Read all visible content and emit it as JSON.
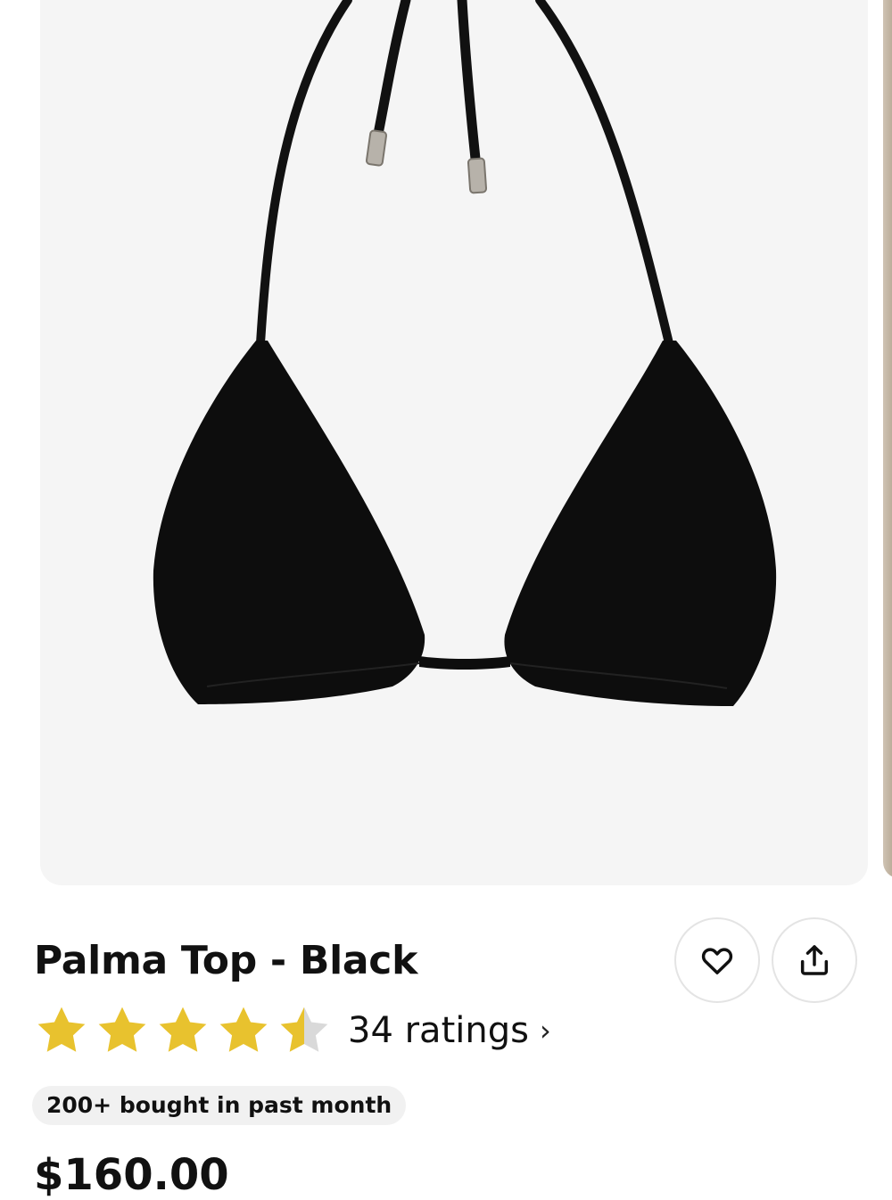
{
  "product": {
    "title": "Palma Top - Black",
    "rating": 4.5,
    "rating_max": 5,
    "ratings_label": "34 ratings",
    "ratings_chevron": "›",
    "bought_badge": "200+ bought in past month",
    "price": "$160.00"
  },
  "actions": {
    "favorite_icon": "heart-icon",
    "share_icon": "share-icon"
  },
  "colors": {
    "star": "#E8C22E",
    "star_empty": "#D9D9D9",
    "image_bg": "#F5F5F5",
    "product": "#0D0D0D"
  }
}
